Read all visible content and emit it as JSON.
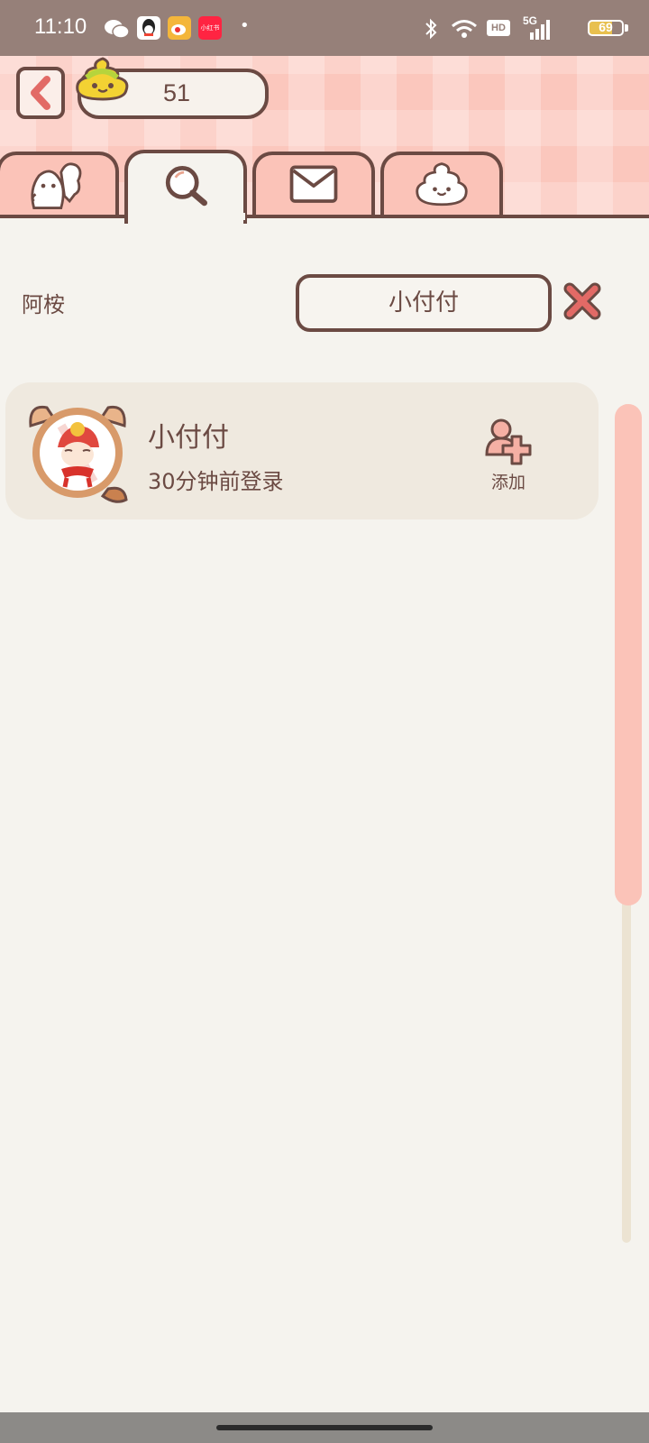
{
  "status_bar": {
    "time": "11:10",
    "notification_icons": [
      "wechat-icon",
      "qq-icon",
      "weibo-icon",
      "xiaohongshu-icon"
    ],
    "xiaohongshu_label": "小红书",
    "dot": "•",
    "hd_label": "HD",
    "network_label": "5G",
    "battery": "69"
  },
  "header": {
    "coin_count": "51"
  },
  "tabs": [
    {
      "name": "friends",
      "icon": "ghost-friends-icon",
      "active": false
    },
    {
      "name": "search",
      "icon": "magnifier-icon",
      "active": true
    },
    {
      "name": "mail",
      "icon": "envelope-icon",
      "active": false
    },
    {
      "name": "poop",
      "icon": "poop-icon",
      "active": false
    }
  ],
  "search": {
    "label": "阿桉",
    "query": "小付付"
  },
  "results": [
    {
      "name": "小付付",
      "status": "30分钟前登录",
      "action_label": "添加"
    }
  ],
  "scrollbar": {
    "thumb_fraction": 0.6
  },
  "colors": {
    "accent_pink": "#fbc3b8",
    "brown": "#6b4a43",
    "cream": "#f5f3ee",
    "card": "#efe9df",
    "close_red": "#e26a66"
  }
}
